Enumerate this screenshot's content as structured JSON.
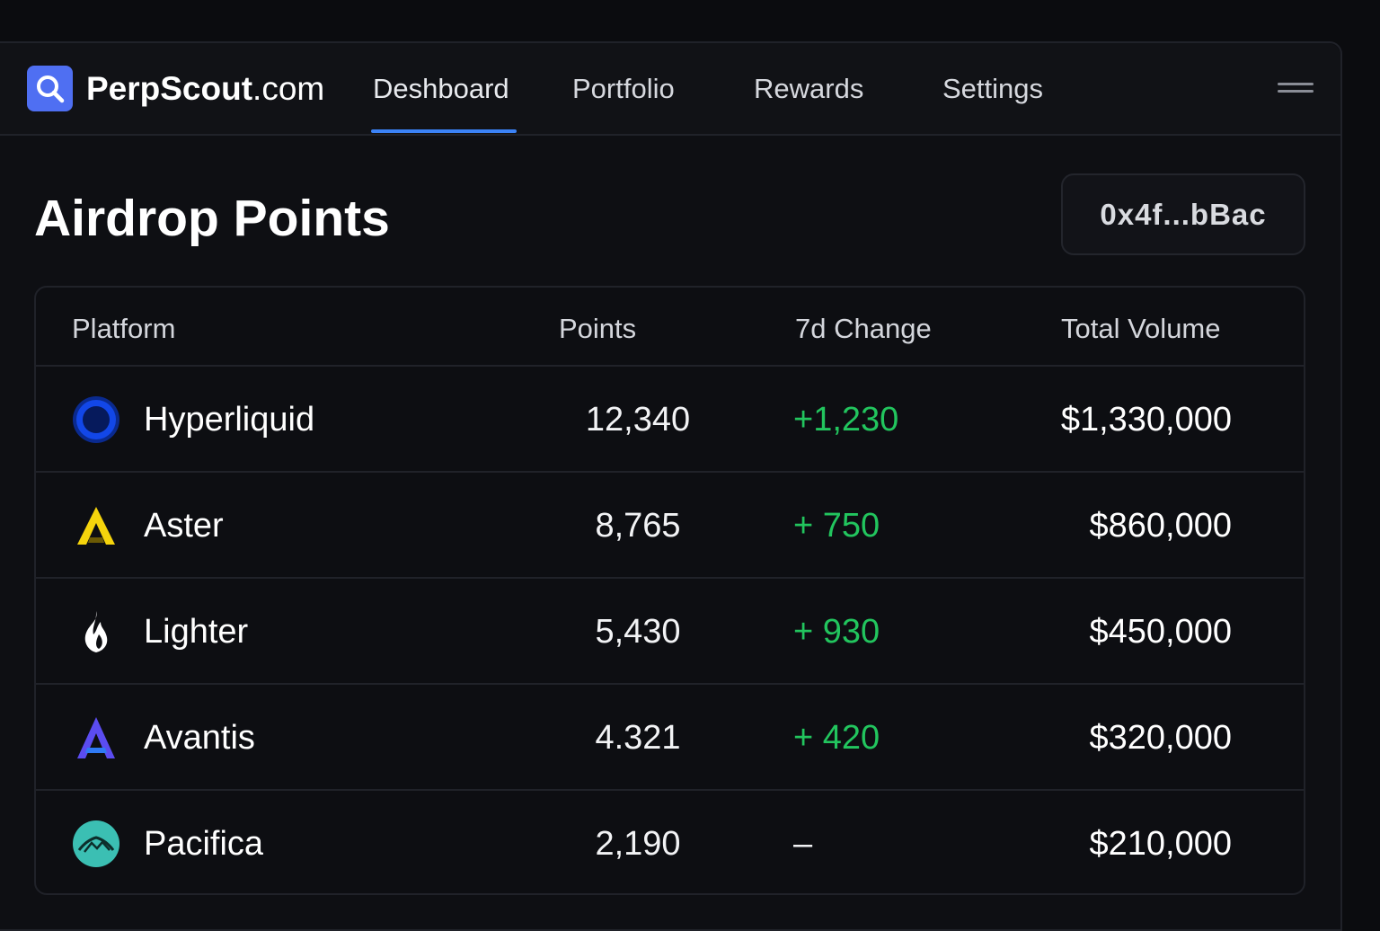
{
  "header": {
    "brand_bold": "PerpScout",
    "brand_suffix": ".com",
    "nav": [
      {
        "label": "Deshboard",
        "active": true
      },
      {
        "label": "Portfolio",
        "active": false
      },
      {
        "label": "Rewards",
        "active": false
      },
      {
        "label": "Settings",
        "active": false
      }
    ]
  },
  "main": {
    "title": "Airdrop Points",
    "wallet": "0x4f...bBac"
  },
  "table": {
    "columns": [
      "Platform",
      "Points",
      "7d Change",
      "Total Volume"
    ],
    "rows": [
      {
        "platform": "Hyperliquid",
        "icon": "hyperliquid-icon",
        "points": "12,340",
        "change": "+1,230",
        "volume": "$1,330,000"
      },
      {
        "platform": "Aster",
        "icon": "aster-icon",
        "points": "8,765",
        "change": "+ 750",
        "volume": "$860,000"
      },
      {
        "platform": "Lighter",
        "icon": "lighter-flame-icon",
        "points": "5,430",
        "change": "+ 930",
        "volume": "$450,000"
      },
      {
        "platform": "Avantis",
        "icon": "avantis-icon",
        "points": "4.321",
        "change": "+ 420",
        "volume": "$320,000"
      },
      {
        "platform": "Pacifica",
        "icon": "pacifica-icon",
        "points": "2,190",
        "change": "–",
        "volume": "$210,000"
      }
    ]
  },
  "colors": {
    "accent": "#3b82f6",
    "logo_bg": "#4f6ff2",
    "positive": "#22c55e",
    "background": "#0e0f13"
  }
}
